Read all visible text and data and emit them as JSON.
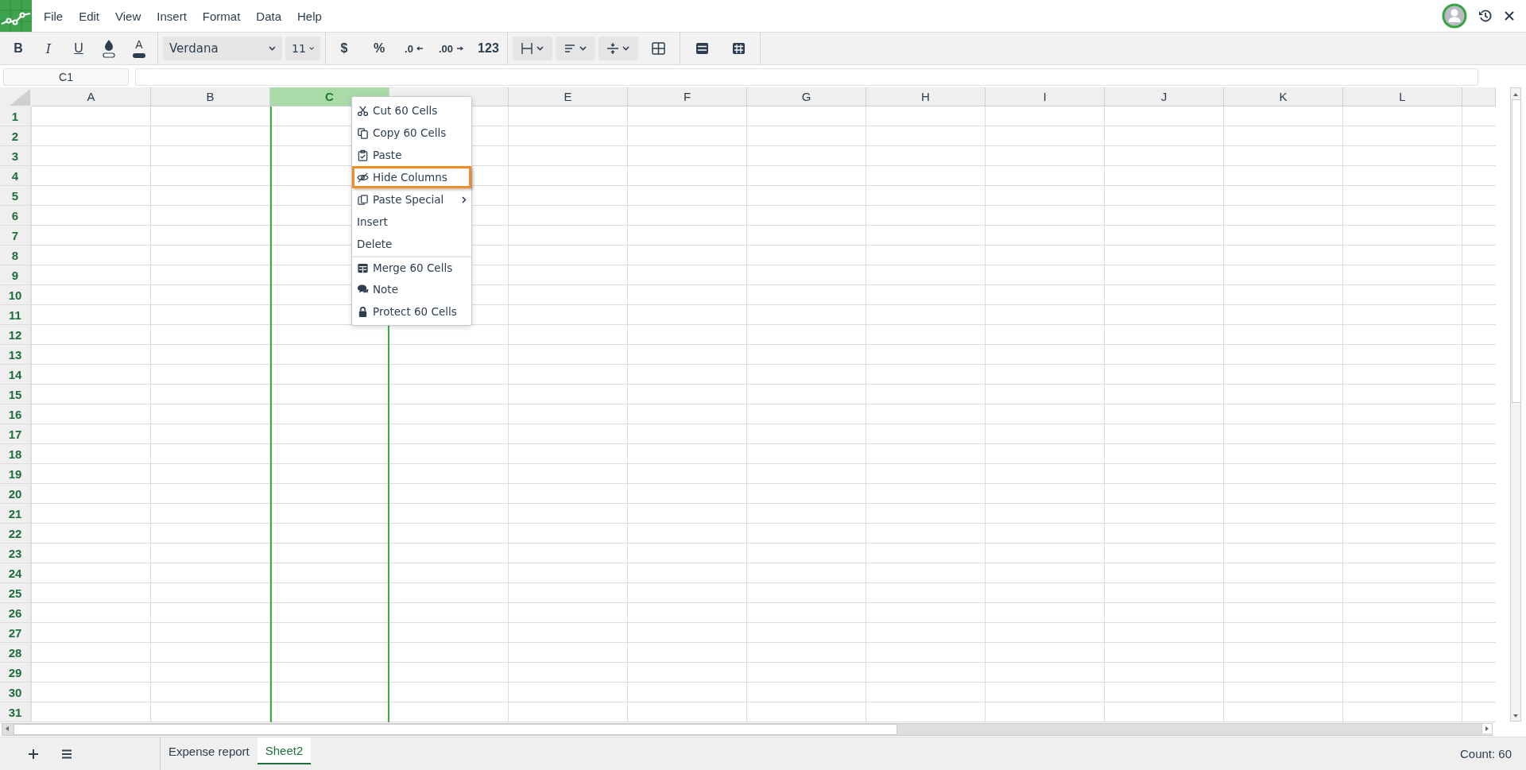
{
  "menu": [
    "File",
    "Edit",
    "View",
    "Insert",
    "Format",
    "Data",
    "Help"
  ],
  "toolbar": {
    "bold": "B",
    "italic": "I",
    "underline": "U",
    "text_color": "A",
    "font": "Verdana",
    "size": "11",
    "currency": "$",
    "percent": "%",
    "decrease_decimals": ".0",
    "increase_decimals": ".00",
    "number_format": "123"
  },
  "name_box": "C1",
  "columns": [
    {
      "label": "A",
      "selected": false
    },
    {
      "label": "B",
      "selected": false
    },
    {
      "label": "C",
      "selected": true
    },
    {
      "selected": false
    },
    {
      "label": "E",
      "selected": false
    },
    {
      "label": "F",
      "selected": false
    },
    {
      "label": "G",
      "selected": false
    },
    {
      "label": "H",
      "selected": false
    },
    {
      "label": "I",
      "selected": false
    },
    {
      "label": "J",
      "selected": false
    },
    {
      "label": "K",
      "selected": false
    },
    {
      "label": "L",
      "selected": false
    }
  ],
  "rows": [
    {
      "label": "1",
      "selected": true
    },
    {
      "label": "2",
      "selected": true
    },
    {
      "label": "3",
      "selected": true
    },
    {
      "label": "4",
      "selected": true
    },
    {
      "label": "5",
      "selected": true
    },
    {
      "label": "6",
      "selected": true
    },
    {
      "label": "7",
      "selected": true
    },
    {
      "label": "8",
      "selected": true
    },
    {
      "label": "9",
      "selected": true
    },
    {
      "label": "10",
      "selected": true
    },
    {
      "label": "11",
      "selected": true
    },
    {
      "label": "12",
      "selected": true
    },
    {
      "label": "13",
      "selected": true
    },
    {
      "label": "14",
      "selected": true
    },
    {
      "label": "15",
      "selected": true
    },
    {
      "label": "16",
      "selected": true
    },
    {
      "label": "17",
      "selected": true
    },
    {
      "label": "18",
      "selected": true
    },
    {
      "label": "19",
      "selected": true
    },
    {
      "label": "20",
      "selected": true
    },
    {
      "label": "21",
      "selected": true
    },
    {
      "label": "22",
      "selected": true
    },
    {
      "label": "23",
      "selected": true
    },
    {
      "label": "24",
      "selected": true
    },
    {
      "label": "25",
      "selected": true
    },
    {
      "label": "26",
      "selected": true
    },
    {
      "label": "27",
      "selected": true
    },
    {
      "label": "28",
      "selected": true
    },
    {
      "label": "29",
      "selected": true
    },
    {
      "label": "30",
      "selected": true
    },
    {
      "label": "31",
      "selected": true
    }
  ],
  "context_menu": [
    {
      "label": "Cut 60 Cells",
      "kind": "cut",
      "highlighted": false,
      "submenu": false,
      "separator_before": false
    },
    {
      "label": "Copy 60 Cells",
      "kind": "copy",
      "highlighted": false,
      "submenu": false,
      "separator_before": false
    },
    {
      "label": "Paste",
      "kind": "paste",
      "highlighted": false,
      "submenu": false,
      "separator_before": false
    },
    {
      "label": "Hide Columns",
      "kind": "hide",
      "highlighted": true,
      "submenu": false,
      "separator_before": false
    },
    {
      "label": "Paste Special",
      "kind": "pastespecial",
      "highlighted": false,
      "submenu": true,
      "separator_before": false
    },
    {
      "label": "Insert",
      "kind": "plain",
      "highlighted": false,
      "submenu": false,
      "separator_before": false
    },
    {
      "label": "Delete",
      "kind": "plain",
      "highlighted": false,
      "submenu": false,
      "separator_before": false
    },
    {
      "label": "Merge 60 Cells",
      "kind": "merge",
      "highlighted": false,
      "submenu": false,
      "separator_before": true
    },
    {
      "label": "Note",
      "kind": "note",
      "highlighted": false,
      "submenu": false,
      "separator_before": false
    },
    {
      "label": "Protect 60 Cells",
      "kind": "protect",
      "highlighted": false,
      "submenu": false,
      "separator_before": false
    }
  ],
  "sheets": [
    {
      "label": "Expense report",
      "selected": false
    },
    {
      "label": "Sheet2",
      "selected": true
    }
  ],
  "status": "Count: 60"
}
